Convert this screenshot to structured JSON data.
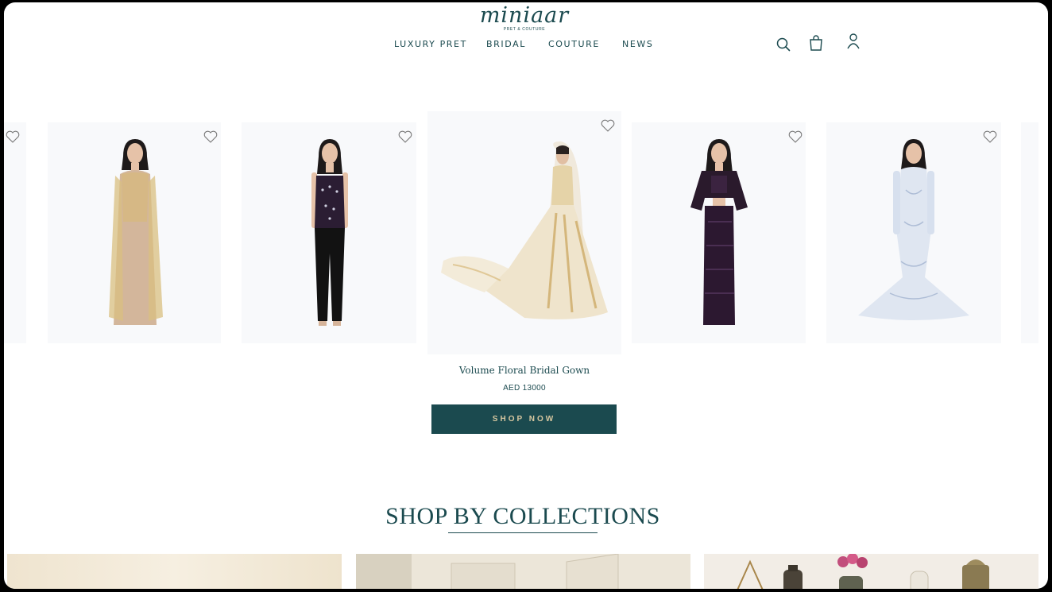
{
  "brand": {
    "name": "miniaar",
    "tagline": "PRET & COUTURE"
  },
  "nav": {
    "items": [
      {
        "label": "LUXURY PRET"
      },
      {
        "label": "BRIDAL"
      },
      {
        "label": "COUTURE"
      },
      {
        "label": "NEWS"
      }
    ]
  },
  "header_icons": [
    "search-icon",
    "bag-icon",
    "user-icon"
  ],
  "carousel": {
    "active_index": 2,
    "products": [
      {
        "name": "nude-embellished-gown"
      },
      {
        "name": "sequin-corset-top-trousers"
      },
      {
        "name": "volume-floral-bridal-gown"
      },
      {
        "name": "plum-sequin-co-ord"
      },
      {
        "name": "ice-blue-gown"
      }
    ],
    "featured": {
      "title": "Volume Floral Bridal Gown",
      "price": "AED 13000",
      "cta": "SHOP NOW"
    }
  },
  "collections": {
    "heading": "SHOP BY COLLECTIONS"
  },
  "colors": {
    "brand_teal": "#1b4a4f",
    "cta_text": "#d7c7a0",
    "card_bg": "#f8f9fb"
  }
}
